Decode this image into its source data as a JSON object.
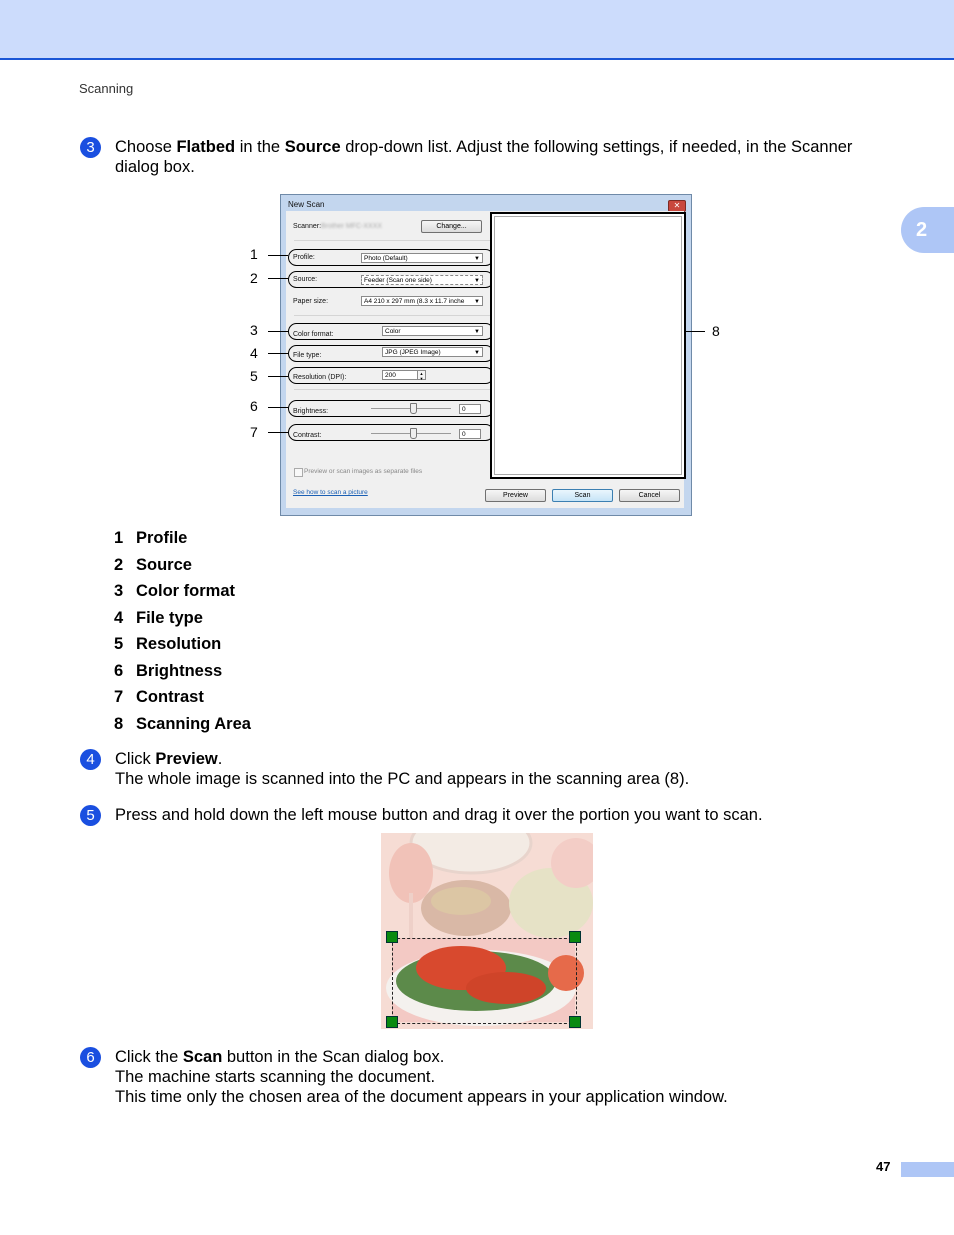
{
  "header": {
    "running_head": "Scanning",
    "chapter_tab": "2"
  },
  "steps": {
    "s3": {
      "number": "3",
      "text_parts": [
        "Choose ",
        "Flatbed",
        " in the ",
        "Source",
        " drop-down list. Adjust the following settings, if needed, in the Scanner"
      ],
      "line2": "dialog box."
    },
    "s4": {
      "number": "4",
      "text_parts": [
        "Click ",
        "Preview",
        "."
      ],
      "line2": "The whole image is scanned into the PC and appears in the scanning area (8)."
    },
    "s5": {
      "number": "5",
      "text": "Press and hold down the left mouse button and drag it over the portion you want to scan."
    },
    "s6": {
      "number": "6",
      "text_parts": [
        "Click the ",
        "Scan",
        " button in the Scan dialog box."
      ],
      "line2": "The machine starts scanning the document.",
      "line3": "This time only the chosen area of the document appears in your application window."
    }
  },
  "dialog": {
    "title": "New Scan",
    "close_icon": "close-icon",
    "scanner_label": "Scanner:",
    "scanner_value": "Brother MFC-XXXX",
    "change_button": "Change...",
    "profile_label": "Profile:",
    "profile_value": "Photo (Default)",
    "source_label": "Source:",
    "source_value": "Feeder (Scan one side)",
    "paper_size_label": "Paper size:",
    "paper_size_value": "A4 210 x 297 mm (8.3 x 11.7 inche",
    "color_format_label": "Color format:",
    "color_format_value": "Color",
    "file_type_label": "File type:",
    "file_type_value": "JPG (JPEG Image)",
    "resolution_label": "Resolution (DPI):",
    "resolution_value": "200",
    "brightness_label": "Brightness:",
    "brightness_value": "0",
    "contrast_label": "Contrast:",
    "contrast_value": "0",
    "separate_files_label": "Preview or scan images as separate files",
    "help_link": "See how to scan a picture",
    "preview_button": "Preview",
    "scan_button": "Scan",
    "cancel_button": "Cancel",
    "callouts": [
      "1",
      "2",
      "3",
      "4",
      "5",
      "6",
      "7",
      "8"
    ]
  },
  "legend": [
    {
      "n": "1",
      "label": "Profile"
    },
    {
      "n": "2",
      "label": "Source"
    },
    {
      "n": "3",
      "label": "Color format"
    },
    {
      "n": "4",
      "label": "File type"
    },
    {
      "n": "5",
      "label": "Resolution"
    },
    {
      "n": "6",
      "label": "Brightness"
    },
    {
      "n": "7",
      "label": "Contrast"
    },
    {
      "n": "8",
      "label": "Scanning Area"
    }
  ],
  "footer": {
    "page_number": "47"
  }
}
